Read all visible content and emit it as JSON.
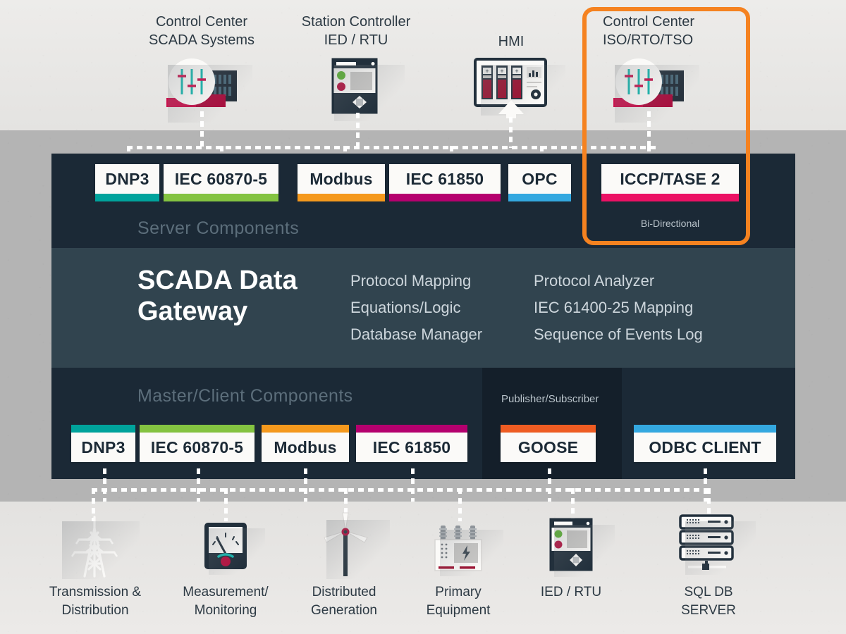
{
  "diagram": {
    "title": "SCADA Data Gateway",
    "colors": {
      "panel_dark": "#1b2936",
      "panel_core": "#31444f",
      "panel_pubsub": "#141f2a",
      "highlight_orange": "#f58220",
      "teal": "#00a39c",
      "green": "#84c341",
      "orange": "#f5991d",
      "magenta": "#b5006e",
      "blue": "#34a8e0",
      "pink": "#ec1164",
      "orange_red": "#ef5c22"
    }
  },
  "top_nodes": [
    {
      "label_line1": "Control Center",
      "label_line2": "SCADA Systems",
      "icon": "control-center-mixer-icon"
    },
    {
      "label_line1": "Station Controller",
      "label_line2": "IED / RTU",
      "icon": "rtu-device-icon"
    },
    {
      "label_line1": "HMI",
      "label_line2": "",
      "icon": "hmi-monitor-icon"
    },
    {
      "label_line1": "Control Center",
      "label_line2": "ISO/RTO/TSO",
      "icon": "control-center-mixer-icon"
    }
  ],
  "server_section": {
    "caption": "Server Components",
    "chips": [
      {
        "label": "DNP3",
        "color": "#00a39c"
      },
      {
        "label": "IEC 60870-5",
        "color": "#84c341"
      },
      {
        "label": "Modbus",
        "color": "#f5991d"
      },
      {
        "label": "IEC 61850",
        "color": "#b5006e"
      },
      {
        "label": "OPC",
        "color": "#34a8e0"
      },
      {
        "label": "ICCP/TASE  2",
        "color": "#ec1164"
      }
    ],
    "iccp_note": "Bi-Directional"
  },
  "core_section": {
    "title_line1": "SCADA Data",
    "title_line2": "Gateway",
    "features_left": [
      "Protocol Mapping",
      "Equations/Logic",
      "Database Manager"
    ],
    "features_right": [
      "Protocol Analyzer",
      "IEC 61400-25 Mapping",
      "Sequence of Events Log"
    ]
  },
  "master_section": {
    "caption": "Master/Client Components",
    "pubsub_caption": "Publisher/Subscriber",
    "chips": [
      {
        "label": "DNP3",
        "color": "#00a39c"
      },
      {
        "label": "IEC 60870-5",
        "color": "#84c341"
      },
      {
        "label": "Modbus",
        "color": "#f5991d"
      },
      {
        "label": "IEC 61850",
        "color": "#b5006e"
      },
      {
        "label": "GOOSE",
        "color": "#ef5c22"
      },
      {
        "label": "ODBC CLIENT",
        "color": "#34a8e0"
      }
    ]
  },
  "bottom_nodes": [
    {
      "label_line1": "Transmission &",
      "label_line2": "Distribution",
      "icon": "transmission-tower-icon"
    },
    {
      "label_line1": "Measurement/",
      "label_line2": "Monitoring",
      "icon": "analog-meter-icon"
    },
    {
      "label_line1": "Distributed",
      "label_line2": "Generation",
      "icon": "wind-turbine-icon"
    },
    {
      "label_line1": "Primary",
      "label_line2": "Equipment",
      "icon": "transformer-icon"
    },
    {
      "label_line1": "IED / RTU",
      "label_line2": "",
      "icon": "rtu-device-icon"
    },
    {
      "label_line1": "SQL DB",
      "label_line2": "SERVER",
      "icon": "server-rack-icon"
    }
  ]
}
